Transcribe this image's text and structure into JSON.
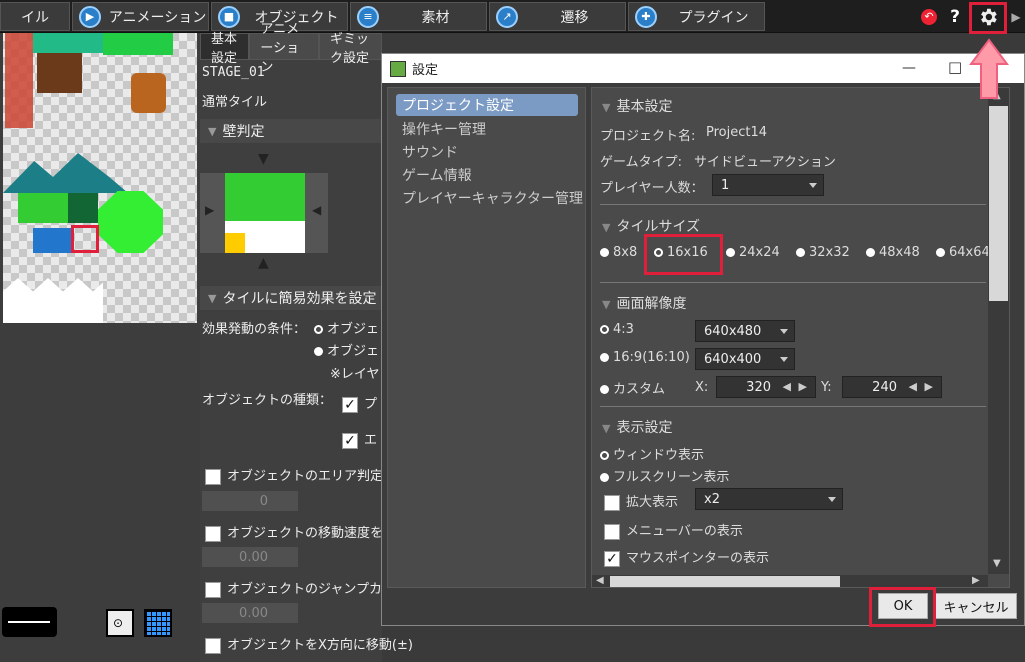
{
  "menubar": {
    "tabs": [
      {
        "label": "イル"
      },
      {
        "label": "アニメーション"
      },
      {
        "label": "オブジェクト"
      },
      {
        "label": "素材"
      },
      {
        "label": "遷移"
      },
      {
        "label": "プラグイン"
      }
    ],
    "help_label": "?"
  },
  "midpanel": {
    "tabs": [
      "基本設定",
      "アニメーション",
      "ギミック設定"
    ],
    "stage_name": "STAGE_01",
    "tile_kind": "通常タイル",
    "wall_section": "壁判定",
    "effect_section": "タイルに簡易効果を設定",
    "effect_condition_label": "効果発動の条件：",
    "effect_condition_opt1": "オブジェ",
    "effect_condition_opt2": "オブジェ",
    "effect_condition_note": "※レイヤ",
    "object_kind_label": "オブジェクトの種類：",
    "object_kind_opt1": "プ",
    "object_kind_opt2": "エ",
    "area_check": "オブジェクトのエリア判定",
    "area_value": "0",
    "speed_check": "オブジェクトの移動速度を",
    "speed_value": "0.00",
    "jump_check": "オブジェクトのジャンプカ",
    "jump_value": "0.00",
    "move_x_check": "オブジェクトをX方向に移動(±)"
  },
  "dialog": {
    "title": "設定",
    "minimize": "—",
    "maximize": "□",
    "nav": [
      "プロジェクト設定",
      "操作キー管理",
      "サウンド",
      "ゲーム情報",
      "プレイヤーキャラクター管理"
    ],
    "basic": {
      "header": "基本設定",
      "project_name_label": "プロジェクト名:",
      "project_name": "Project14",
      "game_type_label": "ゲームタイプ:",
      "game_type": "サイドビューアクション",
      "players_label": "プレイヤー人数：",
      "players": "1"
    },
    "tilesize": {
      "header": "タイルサイズ",
      "options": [
        "8x8",
        "16x16",
        "24x24",
        "32x32",
        "48x48",
        "64x64"
      ]
    },
    "resolution": {
      "header": "画面解像度",
      "opt_43": "4:3",
      "val_43": "640x480",
      "opt_169": "16:9(16:10)",
      "val_169": "640x400",
      "opt_custom": "カスタム",
      "x_label": "X:",
      "x_value": "320",
      "y_label": "Y:",
      "y_value": "240"
    },
    "display": {
      "header": "表示設定",
      "window": "ウィンドウ表示",
      "fullscreen": "フルスクリーン表示",
      "zoom_label": "拡大表示",
      "zoom_value": "x2",
      "menubar": "メニューバーの表示",
      "mouse": "マウスポインターの表示"
    },
    "ok_label": "OK",
    "cancel_label": "キャンセル"
  },
  "colors": {
    "highlight": "#e0203a",
    "selection": "#7b9bc4",
    "arrow": "#ff9aa8"
  }
}
